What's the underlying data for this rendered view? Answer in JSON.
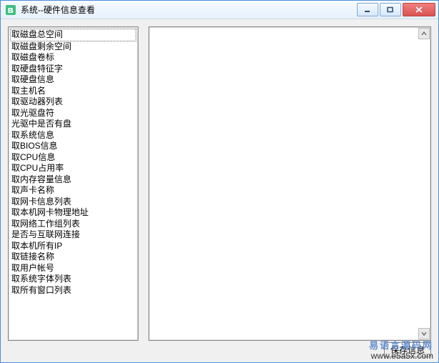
{
  "window": {
    "title": "系统--硬件信息查看"
  },
  "list": {
    "items": [
      "取磁盘总空间",
      "取磁盘剩余空间",
      "取磁盘卷标",
      "取硬盘特征字",
      "取硬盘信息",
      "取主机名",
      "取驱动器列表",
      "取光驱盘符",
      "光驱中是否有盘",
      "取系统信息",
      "取BIOS信息",
      "取CPU信息",
      "取CPU占用率",
      "取内存容量信息",
      "取声卡名称",
      "取网卡信息列表",
      "取本机网卡物理地址",
      "取网络工作组列表",
      "是否与互联网连接",
      "取本机所有IP",
      "取链接名称",
      "取用户帐号",
      "取系统字体列表",
      "取所有窗口列表"
    ],
    "selected_index": 0
  },
  "actions": {
    "save_label": "保存信息"
  },
  "watermark": {
    "line1": "易语言源码网",
    "line2": "www.e5a5x.com"
  }
}
